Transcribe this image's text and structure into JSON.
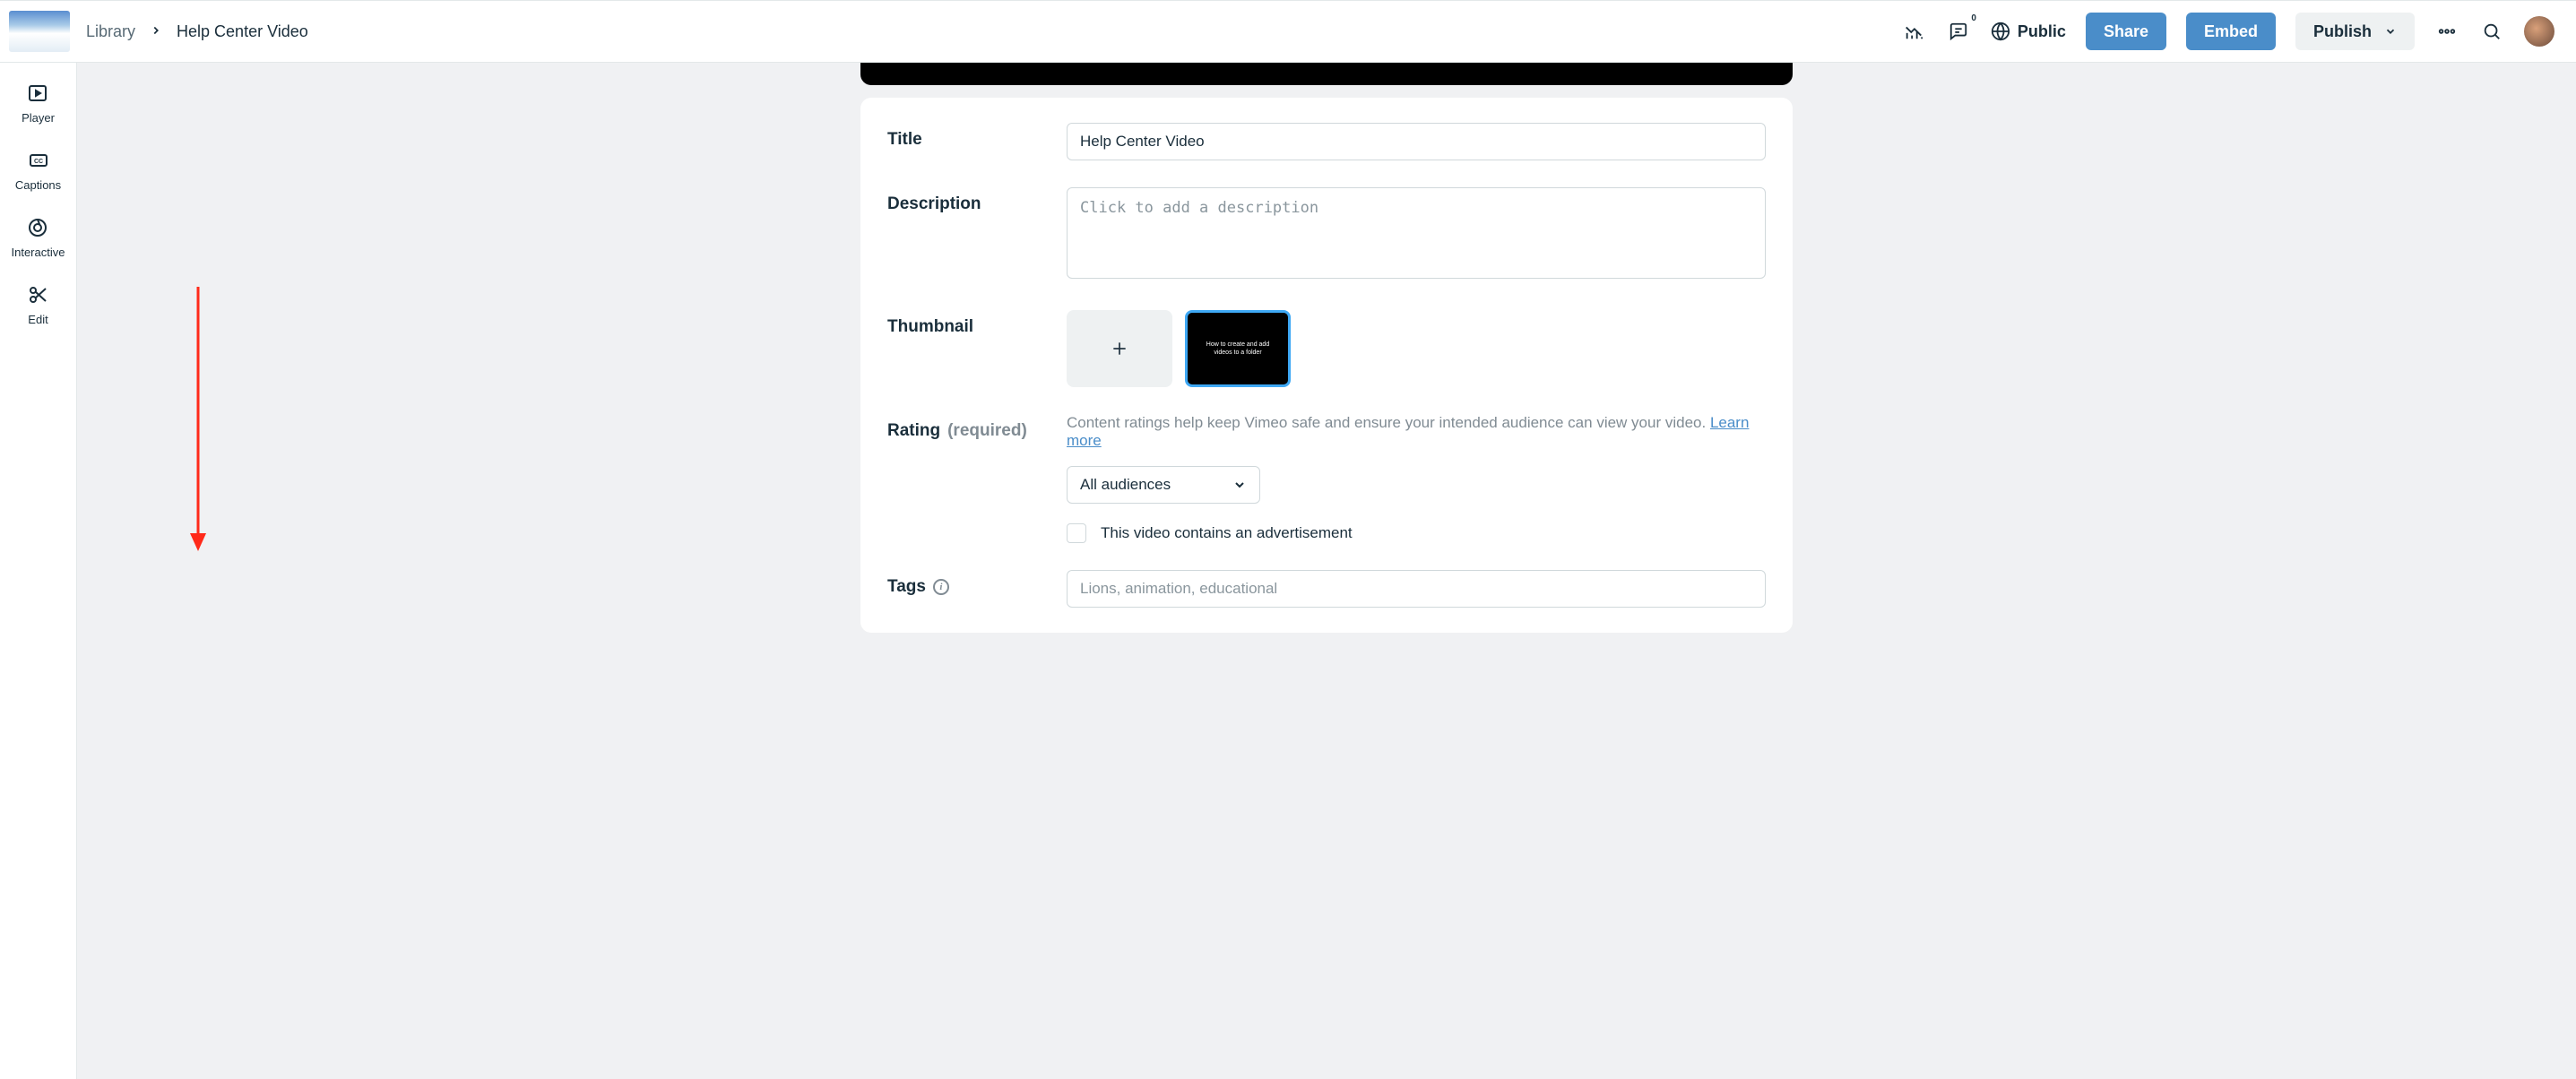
{
  "breadcrumb": {
    "library": "Library",
    "current": "Help Center Video"
  },
  "header": {
    "comments_badge": "0",
    "privacy": "Public",
    "share": "Share",
    "embed": "Embed",
    "publish": "Publish"
  },
  "sidebar": {
    "player": "Player",
    "captions": "Captions",
    "interactive": "Interactive",
    "edit": "Edit"
  },
  "form": {
    "title_label": "Title",
    "title_value": "Help Center Video",
    "desc_label": "Description",
    "desc_placeholder": "Click to add a description",
    "thumb_label": "Thumbnail",
    "thumb_caption": "How to create and add videos to a folder",
    "rating_label": "Rating",
    "rating_required": "(required)",
    "rating_help": "Content ratings help keep Vimeo safe and ensure your intended audience can view your video. ",
    "rating_learn": "Learn more",
    "rating_value": "All audiences",
    "ad_label": "This video contains an advertisement",
    "tags_label": "Tags",
    "tags_placeholder": "Lions, animation, educational"
  }
}
